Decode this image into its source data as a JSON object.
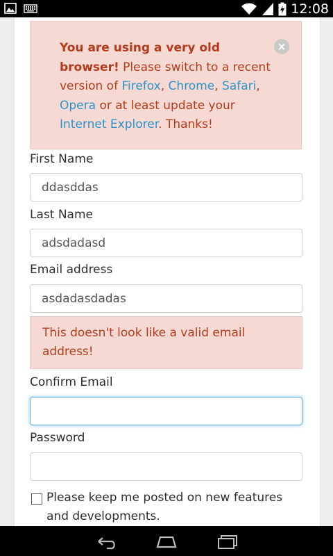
{
  "status_bar": {
    "time": "12:08",
    "left_icons": [
      "picture-icon",
      "keyboard-icon"
    ],
    "right_icons": [
      "wifi-icon",
      "signal-icon",
      "battery-charging-icon"
    ]
  },
  "alert": {
    "bold_text": "You are using a very old browser!",
    "text_1": " Please switch to a recent version of ",
    "link_firefox": "Firefox",
    "sep_1": ", ",
    "link_chrome": "Chrome",
    "sep_2": ", ",
    "link_safari": "Safari",
    "sep_3": ", ",
    "link_opera": "Opera",
    "text_2": " or at least update your ",
    "link_ie": "Internet Explorer",
    "text_3": ". Thanks!",
    "close_symbol": "×"
  },
  "form": {
    "first_name": {
      "label": "First Name",
      "value": "ddasddas"
    },
    "last_name": {
      "label": "Last Name",
      "value": "adsdadasd"
    },
    "email": {
      "label": "Email address",
      "value": "asdadasdadas"
    },
    "email_error": "This doesn't look like a valid email address!",
    "confirm_email": {
      "label": "Confirm Email",
      "value": ""
    },
    "password": {
      "label": "Password",
      "value": ""
    },
    "newsletter": {
      "label": "Please keep me posted on new features and developments.",
      "checked": false
    }
  },
  "nav_bar": {
    "buttons": [
      "back-icon",
      "home-icon",
      "recent-apps-icon"
    ]
  },
  "colors": {
    "alert_bg": "#f7d9d3",
    "alert_text": "#b53b1d",
    "link": "#2a92c9",
    "focus_border": "#66afe9"
  }
}
